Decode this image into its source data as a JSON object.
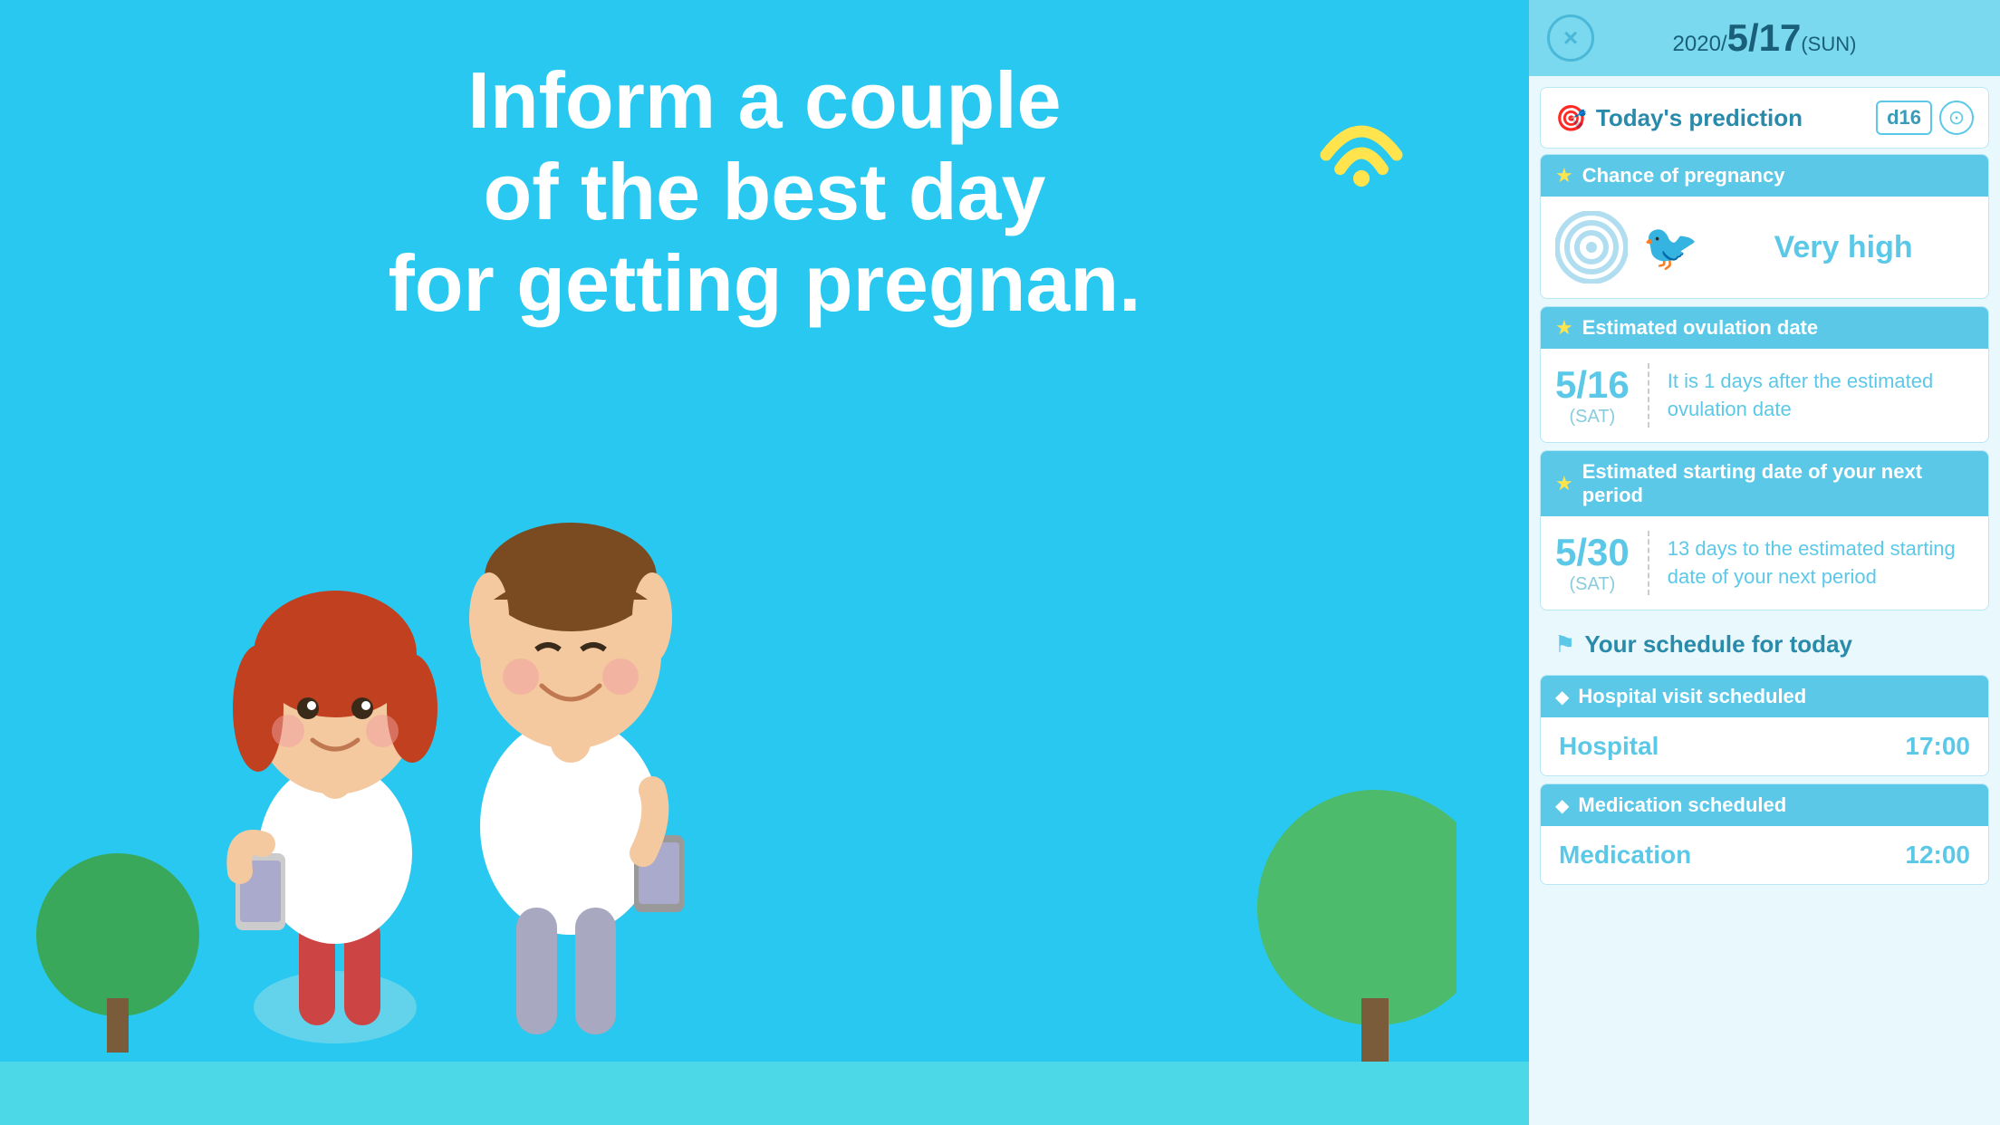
{
  "left": {
    "title_line1": "Inform a couple",
    "title_line2": "of the best day",
    "title_line3": "for getting pregnan."
  },
  "header": {
    "close_label": "×",
    "year": "2020/",
    "month_day": "5/17",
    "day_name": "(SUN)"
  },
  "prediction": {
    "label": "Today's prediction",
    "d_badge": "d16",
    "settings_label": "⚙"
  },
  "chance": {
    "section_title": "Chance of pregnancy",
    "value": "Very high"
  },
  "ovulation": {
    "section_title": "Estimated ovulation date",
    "date": "5/16",
    "day": "(SAT)",
    "description": "It is 1 days after the estimated ovulation date"
  },
  "next_period": {
    "section_title": "Estimated starting date of your next period",
    "date": "5/30",
    "day": "(SAT)",
    "description": "13 days to the estimated starting date of your next period"
  },
  "schedule": {
    "section_title": "Your schedule for today",
    "items": [
      {
        "category": "Hospital visit scheduled",
        "name": "Hospital",
        "time": "17:00"
      },
      {
        "category": "Medication scheduled",
        "name": "Medication",
        "time": "12:00"
      }
    ]
  }
}
